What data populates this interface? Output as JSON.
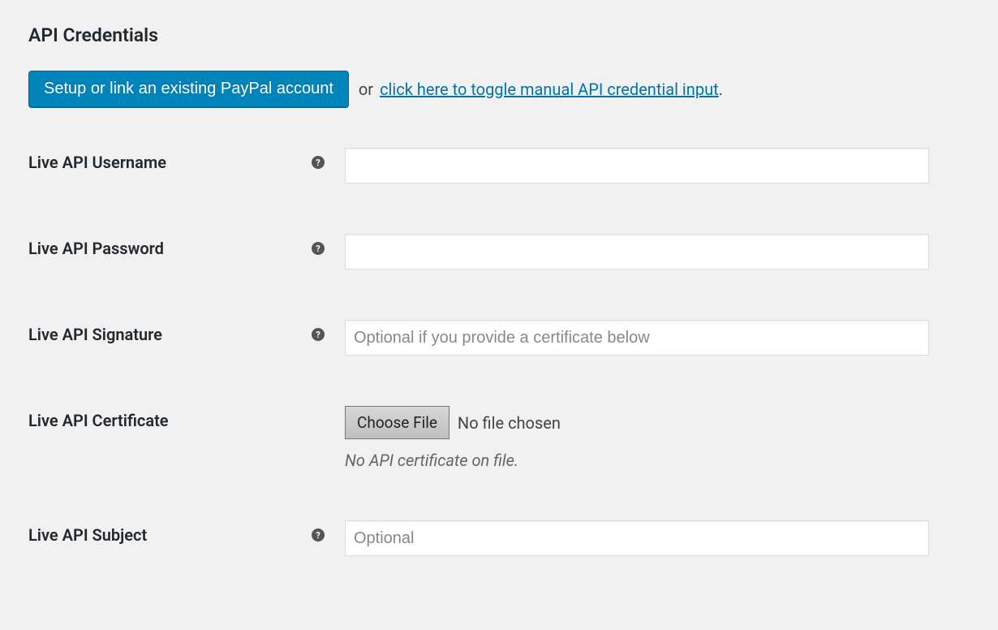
{
  "section": {
    "title": "API Credentials"
  },
  "setup": {
    "button_label": "Setup or link an existing PayPal account",
    "or_text": "or",
    "toggle_link_text": "click here to toggle manual API credential input",
    "period": "."
  },
  "fields": {
    "username": {
      "label": "Live API Username",
      "value": "",
      "placeholder": ""
    },
    "password": {
      "label": "Live API Password",
      "value": "",
      "placeholder": ""
    },
    "signature": {
      "label": "Live API Signature",
      "value": "",
      "placeholder": "Optional if you provide a certificate below"
    },
    "certificate": {
      "label": "Live API Certificate",
      "choose_button": "Choose File",
      "file_status": "No file chosen",
      "note": "No API certificate on file."
    },
    "subject": {
      "label": "Live API Subject",
      "value": "",
      "placeholder": "Optional"
    }
  },
  "help_icon_char": "?"
}
